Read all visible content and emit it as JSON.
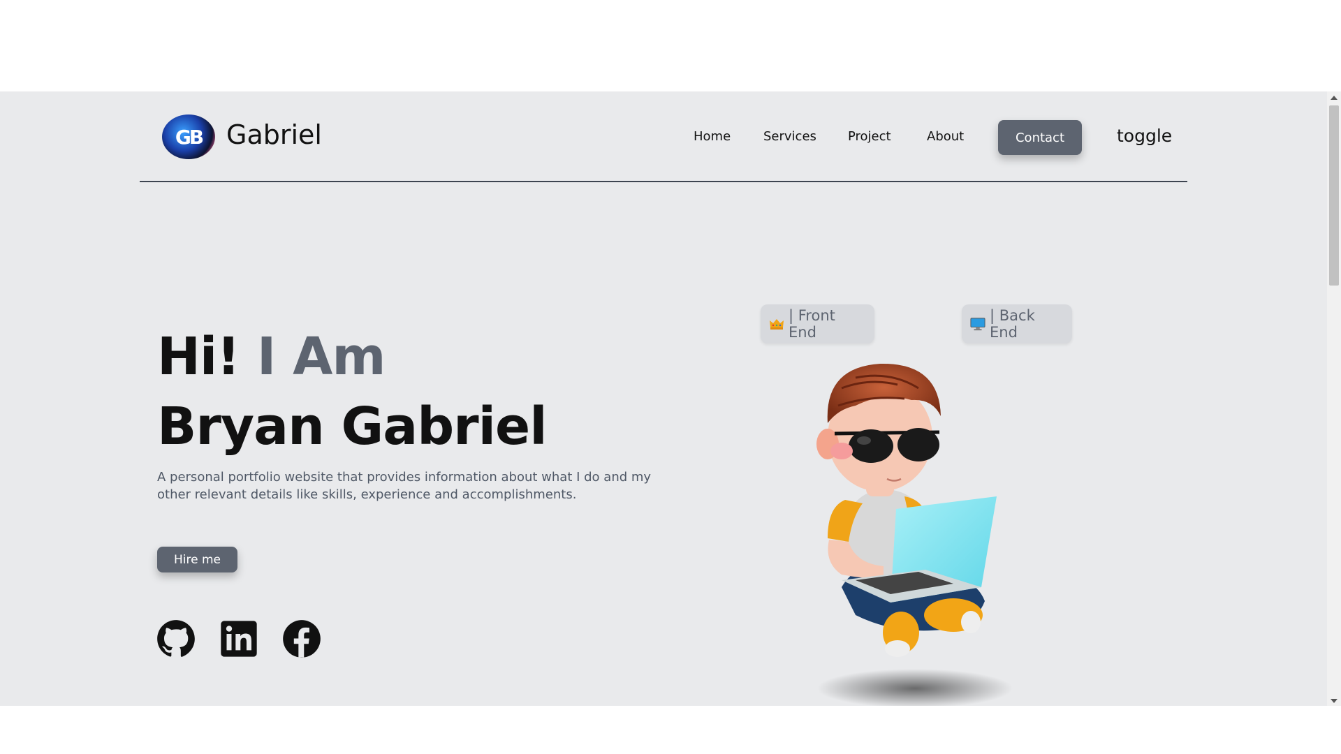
{
  "brand": {
    "name": "Gabriel",
    "logo_text": "GB"
  },
  "nav": {
    "links": [
      "Home",
      "Services",
      "Project",
      "About"
    ],
    "contact_label": "Contact",
    "toggle_label": "toggle"
  },
  "hero": {
    "greeting": "Hi!",
    "greeting_accent": "I Am",
    "name": "Bryan Gabriel",
    "description": "A personal portfolio website that provides information about what I do and my other relevant details like skills, experience and accomplishments.",
    "hire_label": "Hire me"
  },
  "badges": {
    "front": "| Front End",
    "back": "| Back End"
  },
  "social_icons": [
    "github-icon",
    "linkedin-icon",
    "facebook-icon"
  ],
  "colors": {
    "accent": "#5d6470",
    "background": "#e9eaec",
    "text": "#111111"
  }
}
